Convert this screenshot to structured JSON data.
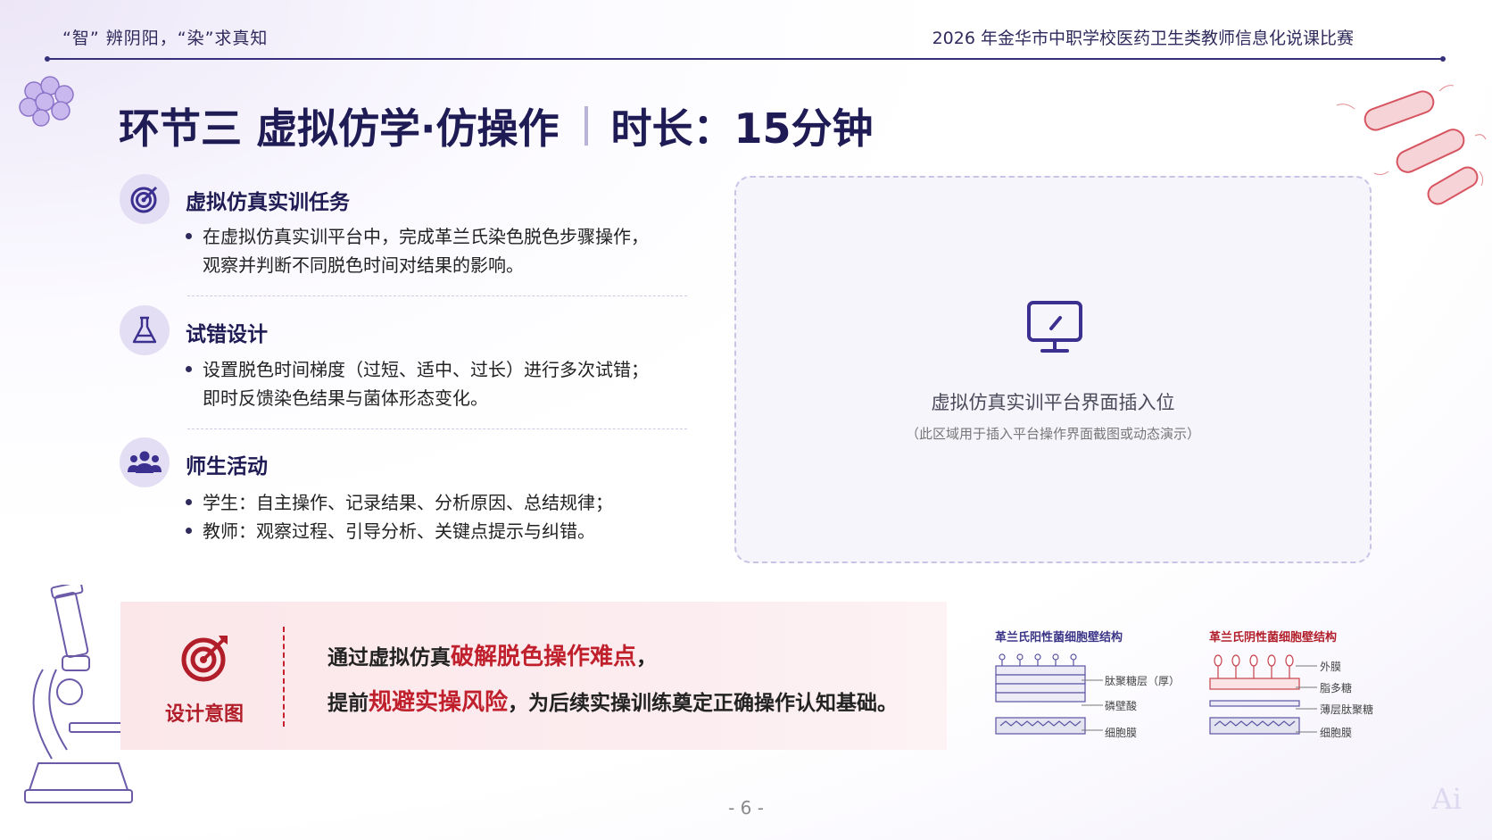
{
  "header": {
    "left_text": "“智”  辨阴阳，“染”求真知",
    "right_text": "2026 年金华市中职学校医药卫生类教师信息化说课比赛"
  },
  "title": {
    "main": "环节三  虚拟仿学·仿操作",
    "duration": "时长：15分钟"
  },
  "sections": [
    {
      "icon": "target-icon",
      "title": "虚拟仿真实训任务",
      "bullets": [
        [
          "在虚拟仿真实训平台中，完成革兰氏染色脱色步骤操作，",
          "观察并判断不同脱色时间对结果的影响。"
        ]
      ]
    },
    {
      "icon": "flask-icon",
      "title": "试错设计",
      "bullets": [
        [
          "设置脱色时间梯度（过短、适中、过长）进行多次试错；",
          "即时反馈染色结果与菌体形态变化。"
        ]
      ]
    },
    {
      "icon": "group-icon",
      "title": "师生活动",
      "bullets": [
        [
          "学生：自主操作、记录结果、分析原因、总结规律；"
        ],
        [
          "教师：观察过程、引导分析、关键点提示与纠错。"
        ]
      ]
    }
  ],
  "placeholder": {
    "icon": "monitor-icon",
    "title": "虚拟仿真实训平台界面插入位",
    "subtitle": "（此区域用于插入平台操作界面截图或动态演示）"
  },
  "intent": {
    "label": "设计意图",
    "line1_pre": "通过虚拟仿真",
    "line1_hl": "破解脱色操作难点",
    "line1_post": "，",
    "line2_pre": "提前",
    "line2_hl": "规避实操风险",
    "line2_post": "，为后续实操训练奠定正确操作认知基础。"
  },
  "diagrams": {
    "positive": {
      "title": "革兰氏阳性菌细胞壁结构",
      "labels": [
        "肽聚糖层（厚）",
        "磷壁酸",
        "细胞膜"
      ]
    },
    "negative": {
      "title": "革兰氏阴性菌细胞壁结构",
      "labels": [
        "外膜",
        "脂多糖",
        "薄层肽聚糖",
        "细胞膜"
      ]
    }
  },
  "page_number": "- 6 -",
  "colors": {
    "navy": "#1f1b54",
    "accent_red": "#c01f2c",
    "lavender": "#e3def3"
  }
}
